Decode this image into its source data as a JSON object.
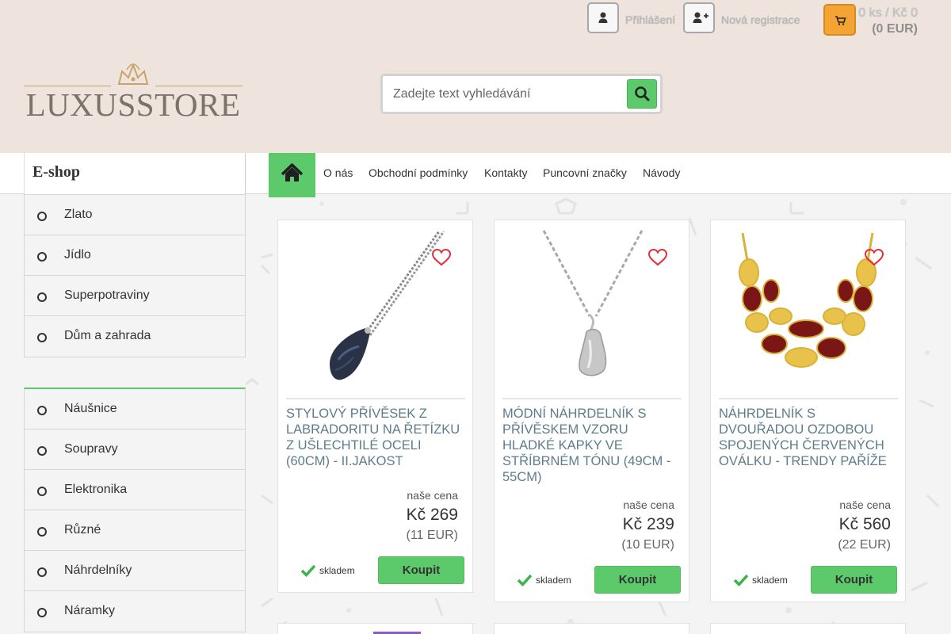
{
  "header": {
    "login_label": "Přihlášení",
    "register_label": "Nová registrace",
    "cart_count": "0 ks / Kč 0",
    "cart_eur": "(0 EUR)",
    "logo_text": "LUXUSSTORE",
    "search_placeholder": "Zadejte text vyhledávání"
  },
  "nav": {
    "eshop_title": "E-shop",
    "links": [
      "O nás",
      "Obchodní podmínky",
      "Kontakty",
      "Puncovní značky",
      "Návody"
    ]
  },
  "sidebar": {
    "group1": [
      "Zlato",
      "Jídlo",
      "Superpotraviny",
      "Dům a zahrada"
    ],
    "group2": [
      "Náušnice",
      "Soupravy",
      "Elektronika",
      "Různé",
      "Náhrdelníky",
      "Náramky"
    ]
  },
  "products": [
    {
      "title": "STYLOVÝ PŘÍVĚSEK Z LABRADORITU NA ŘETÍZKU Z UŠLECHTILÉ OCELI (60CM) - II.JAKOST",
      "price_label": "naše cena",
      "price": "Kč 269",
      "price_eur": "(11 EUR)",
      "stock": "skladem",
      "buy": "Koupit"
    },
    {
      "title": "MÓDNÍ NÁHRDELNÍK S PŘÍVĚSKEM VZORU HLADKÉ KAPKY VE STŘÍBRNÉM TÓNU (49CM - 55CM)",
      "price_label": "naše cena",
      "price": "Kč 239",
      "price_eur": "(10 EUR)",
      "stock": "skladem",
      "buy": "Koupit"
    },
    {
      "title": "NÁHRDELNÍK S DVOUŘADOU OZDOBOU SPOJENÝCH ČERVENÝCH OVÁLKU - TRENDY PAŘÍŽE",
      "price_label": "naše cena",
      "price": "Kč 560",
      "price_eur": "(22 EUR)",
      "stock": "skladem",
      "buy": "Koupit"
    }
  ],
  "colors": {
    "header_bg": "#efe4dd",
    "accent_green": "#5cc96a",
    "cart_orange": "#f4a433",
    "title_blue": "#5e7c8a",
    "heart_red": "#e0303a"
  },
  "icons": {
    "login": "user-icon",
    "register": "user-plus-icon",
    "cart": "shopping-cart-icon",
    "search": "search-icon",
    "home": "home-icon",
    "wishlist": "heart-icon",
    "stock": "check-icon",
    "bullet": "circle-icon"
  }
}
